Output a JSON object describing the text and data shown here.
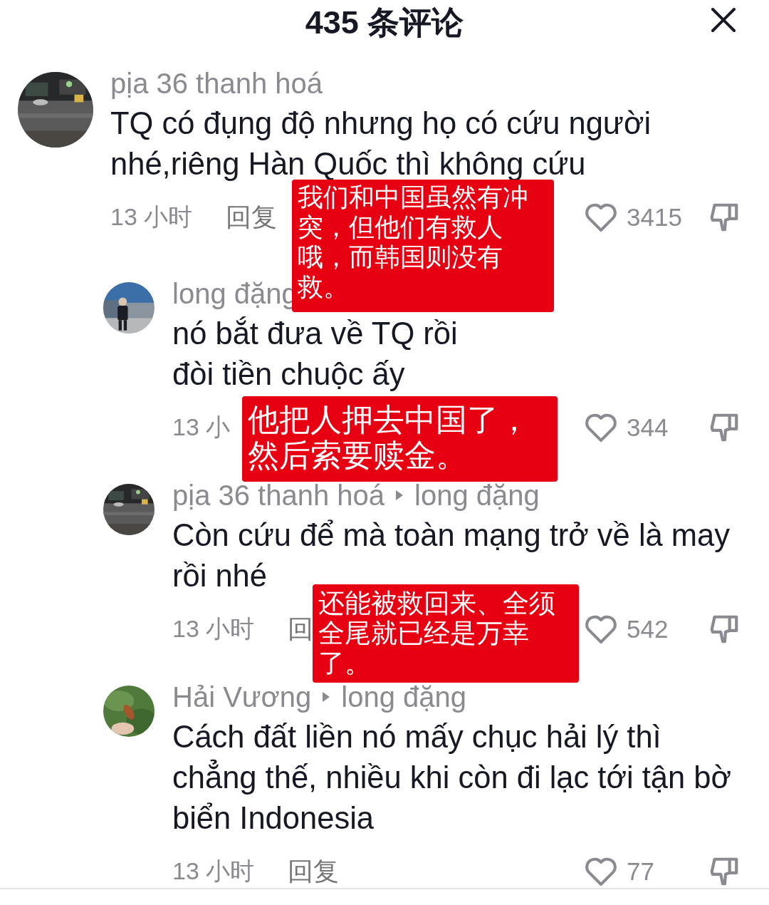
{
  "header": {
    "title": "435 条评论"
  },
  "comments": [
    {
      "kind": "comment",
      "user": "pịa 36 thanh hoá",
      "text": "TQ có đụng độ nhưng họ có cứu người nhé,riêng Hàn Quốc thì không cứu",
      "time": "13 小时",
      "reply_label": "回复",
      "likes": "3415"
    },
    {
      "kind": "reply",
      "user": "long đặng",
      "text": "nó bắt đưa về TQ rồi\nđòi tiền chuộc ấy",
      "time": "13 小",
      "likes": "344"
    },
    {
      "kind": "reply",
      "user": "pịa 36 thanh hoá",
      "reply_to": "long đặng",
      "text": "Còn cứu để mà toàn mạng trở về là may rồi nhé",
      "time": "13 小时",
      "reply_label": "回",
      "likes": "542"
    },
    {
      "kind": "reply",
      "user": "Hải Vương",
      "reply_to": "long đặng",
      "text": "Cách đất liền nó mấy chục hải lý thì chẳng thế, nhiều khi còn đi lạc tới tận bờ biển Indonesia",
      "time": "13 小时",
      "reply_label": "回复",
      "likes": "77"
    }
  ],
  "translations": [
    {
      "text": "我们和中国虽然有冲突，但他们有救人哦，而韩国则没有救。"
    },
    {
      "text": "他把人押去中国了，然后索要赎金。"
    },
    {
      "text": "还能被救回来、全须全尾就已经是万幸了。"
    }
  ]
}
